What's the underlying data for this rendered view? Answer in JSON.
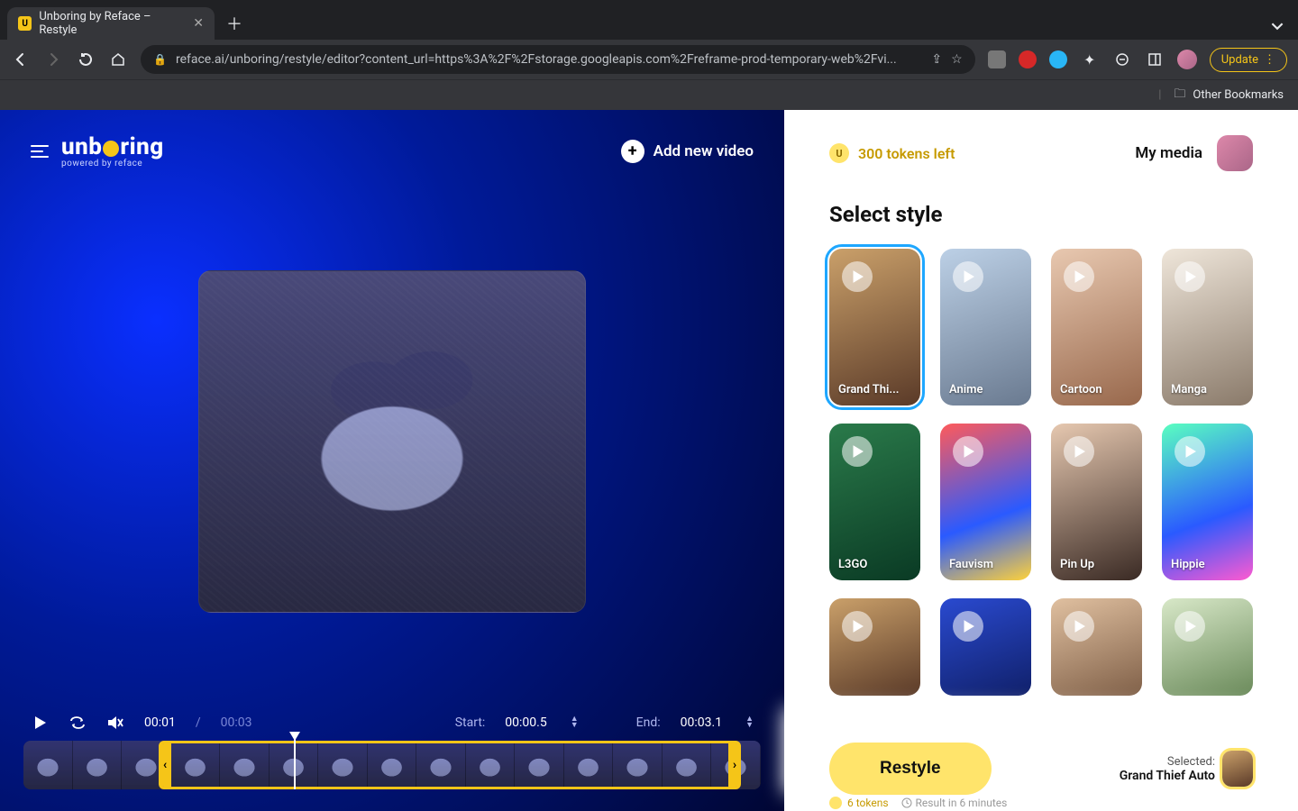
{
  "browser": {
    "tab_title": "Unboring by Reface – Restyle",
    "url": "reface.ai/unboring/restyle/editor?content_url=https%3A%2F%2Fstorage.googleapis.com%2Freframe-prod-temporary-web%2Fvi...",
    "update_label": "Update",
    "other_bookmarks": "Other Bookmarks"
  },
  "header": {
    "logo_text_pre": "unb",
    "logo_text_post": "ring",
    "logo_sub": "powered by reface",
    "add_video": "Add new video"
  },
  "player": {
    "current": "00:01",
    "duration": "00:03",
    "start_label": "Start:",
    "start_value": "00:00.5",
    "end_label": "End:",
    "end_value": "00:03.1"
  },
  "right": {
    "tokens": "300 tokens left",
    "tokens_badge": "U",
    "my_media": "My media",
    "select_style": "Select style",
    "styles": [
      {
        "label": "Grand Thi...",
        "selected": true
      },
      {
        "label": "Anime"
      },
      {
        "label": "Cartoon"
      },
      {
        "label": "Manga"
      },
      {
        "label": "L3GO"
      },
      {
        "label": "Fauvism"
      },
      {
        "label": "Pin Up"
      },
      {
        "label": "Hippie"
      },
      {
        "label": ""
      },
      {
        "label": ""
      },
      {
        "label": ""
      },
      {
        "label": ""
      }
    ],
    "restyle": "Restyle",
    "selected_label": "Selected:",
    "selected_value": "Grand Thief Auto",
    "cost": "6 tokens",
    "eta": "Result in 6 minutes"
  }
}
